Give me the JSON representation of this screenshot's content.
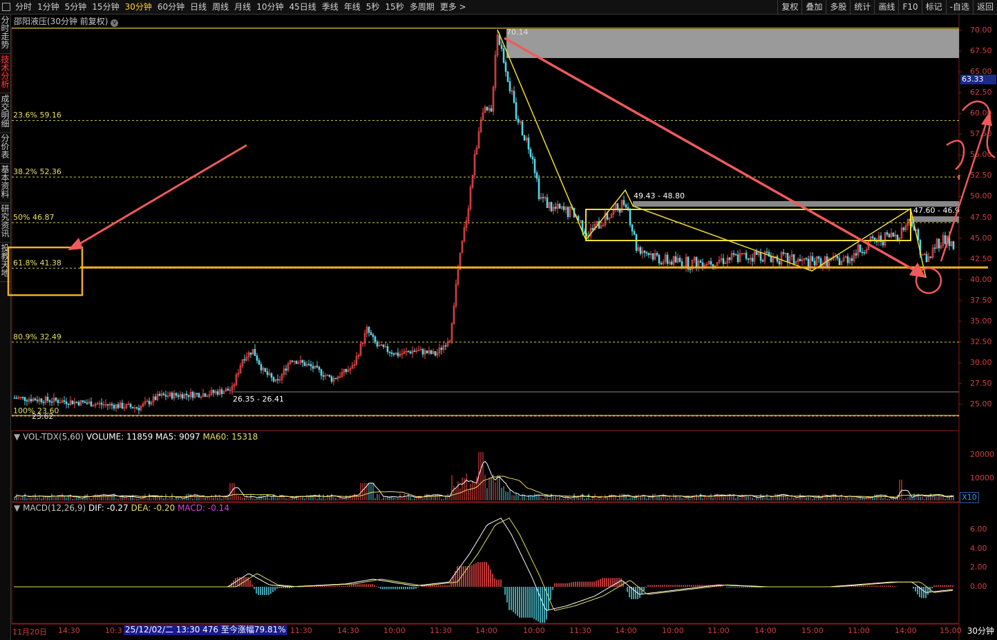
{
  "topbar": {
    "periods": [
      "分时",
      "1分钟",
      "5分钟",
      "15分钟",
      "30分钟",
      "60分钟",
      "日线",
      "周线",
      "月线",
      "10分钟",
      "45日线",
      "季线",
      "年线",
      "5秒",
      "15秒",
      "多周期",
      "更多 >"
    ],
    "active_period": "30分钟",
    "tools": [
      "复权",
      "叠加",
      "多股",
      "统计",
      "画线",
      "F10",
      "标记",
      "-自选",
      "返回"
    ]
  },
  "left_tabs": [
    "分时走势",
    "技术分析",
    "成交明细",
    "分价表",
    "基本资料",
    "研究资讯",
    "投教天地"
  ],
  "left_tab_active": "技术分析",
  "chart": {
    "title": "邵阳液压(30分钟 前复权)",
    "last_price": "63.33",
    "high_label": "70.14",
    "low_label": "23.62",
    "range_label_1": "26.35 - 26.41",
    "range_label_2": "49.43 - 48.80",
    "range_label_3": "47.60 - 46.9",
    "y_ticks": [
      "70.00",
      "67.50",
      "65.00",
      "62.50",
      "60.00",
      "57.50",
      "55.00",
      "52.50",
      "50.00",
      "47.50",
      "45.00",
      "42.50",
      "40.00",
      "37.50",
      "35.00",
      "32.50",
      "30.00",
      "27.50",
      "25.00"
    ],
    "fib_levels": [
      {
        "label": "23.6% 59.16",
        "price": 59.16
      },
      {
        "label": "38.2% 52.36",
        "price": 52.36
      },
      {
        "label": "50% 46.87",
        "price": 46.87
      },
      {
        "label": "61.8% 41.38",
        "price": 41.38
      },
      {
        "label": "80.9% 32.49",
        "price": 32.49
      },
      {
        "label": "100% 23.60",
        "price": 23.6
      }
    ]
  },
  "volume": {
    "header_name": "VOL-TDX(5,60)",
    "volume": "VOLUME: 11859",
    "ma5": "MA5: 9097",
    "ma60": "MA60: 15318",
    "y_ticks": [
      "20000",
      "10000"
    ],
    "x10": "X10"
  },
  "macd": {
    "header_name": "MACD(12,26,9)",
    "dif": "DIF: -0.27",
    "dea": "DEA: -0.20",
    "macd": "MACD: -0.14",
    "y_ticks": [
      "6.00",
      "4.00",
      "2.00",
      "0.00"
    ]
  },
  "x_axis": {
    "labels": [
      "11月20日",
      "14:30",
      "10:3",
      "14:30",
      "11:30",
      "14:30",
      "10:00",
      "11:30",
      "14:00",
      "10:00",
      "11:30",
      "14:00",
      "10:00",
      "11:00",
      "14:00",
      "15:00",
      "11:00",
      "14:00",
      "15:00"
    ],
    "tooltip": "25/12/02/二 13:30 476 至今涨幅79.81%",
    "period": "30分钟"
  },
  "colors": {
    "up": "#ff4a4a",
    "down": "#54d8e8",
    "fib": "#e8e060",
    "annotation_red": "#f05a5a",
    "annotation_yellow": "#f0e030",
    "orange": "#f5b020"
  }
}
